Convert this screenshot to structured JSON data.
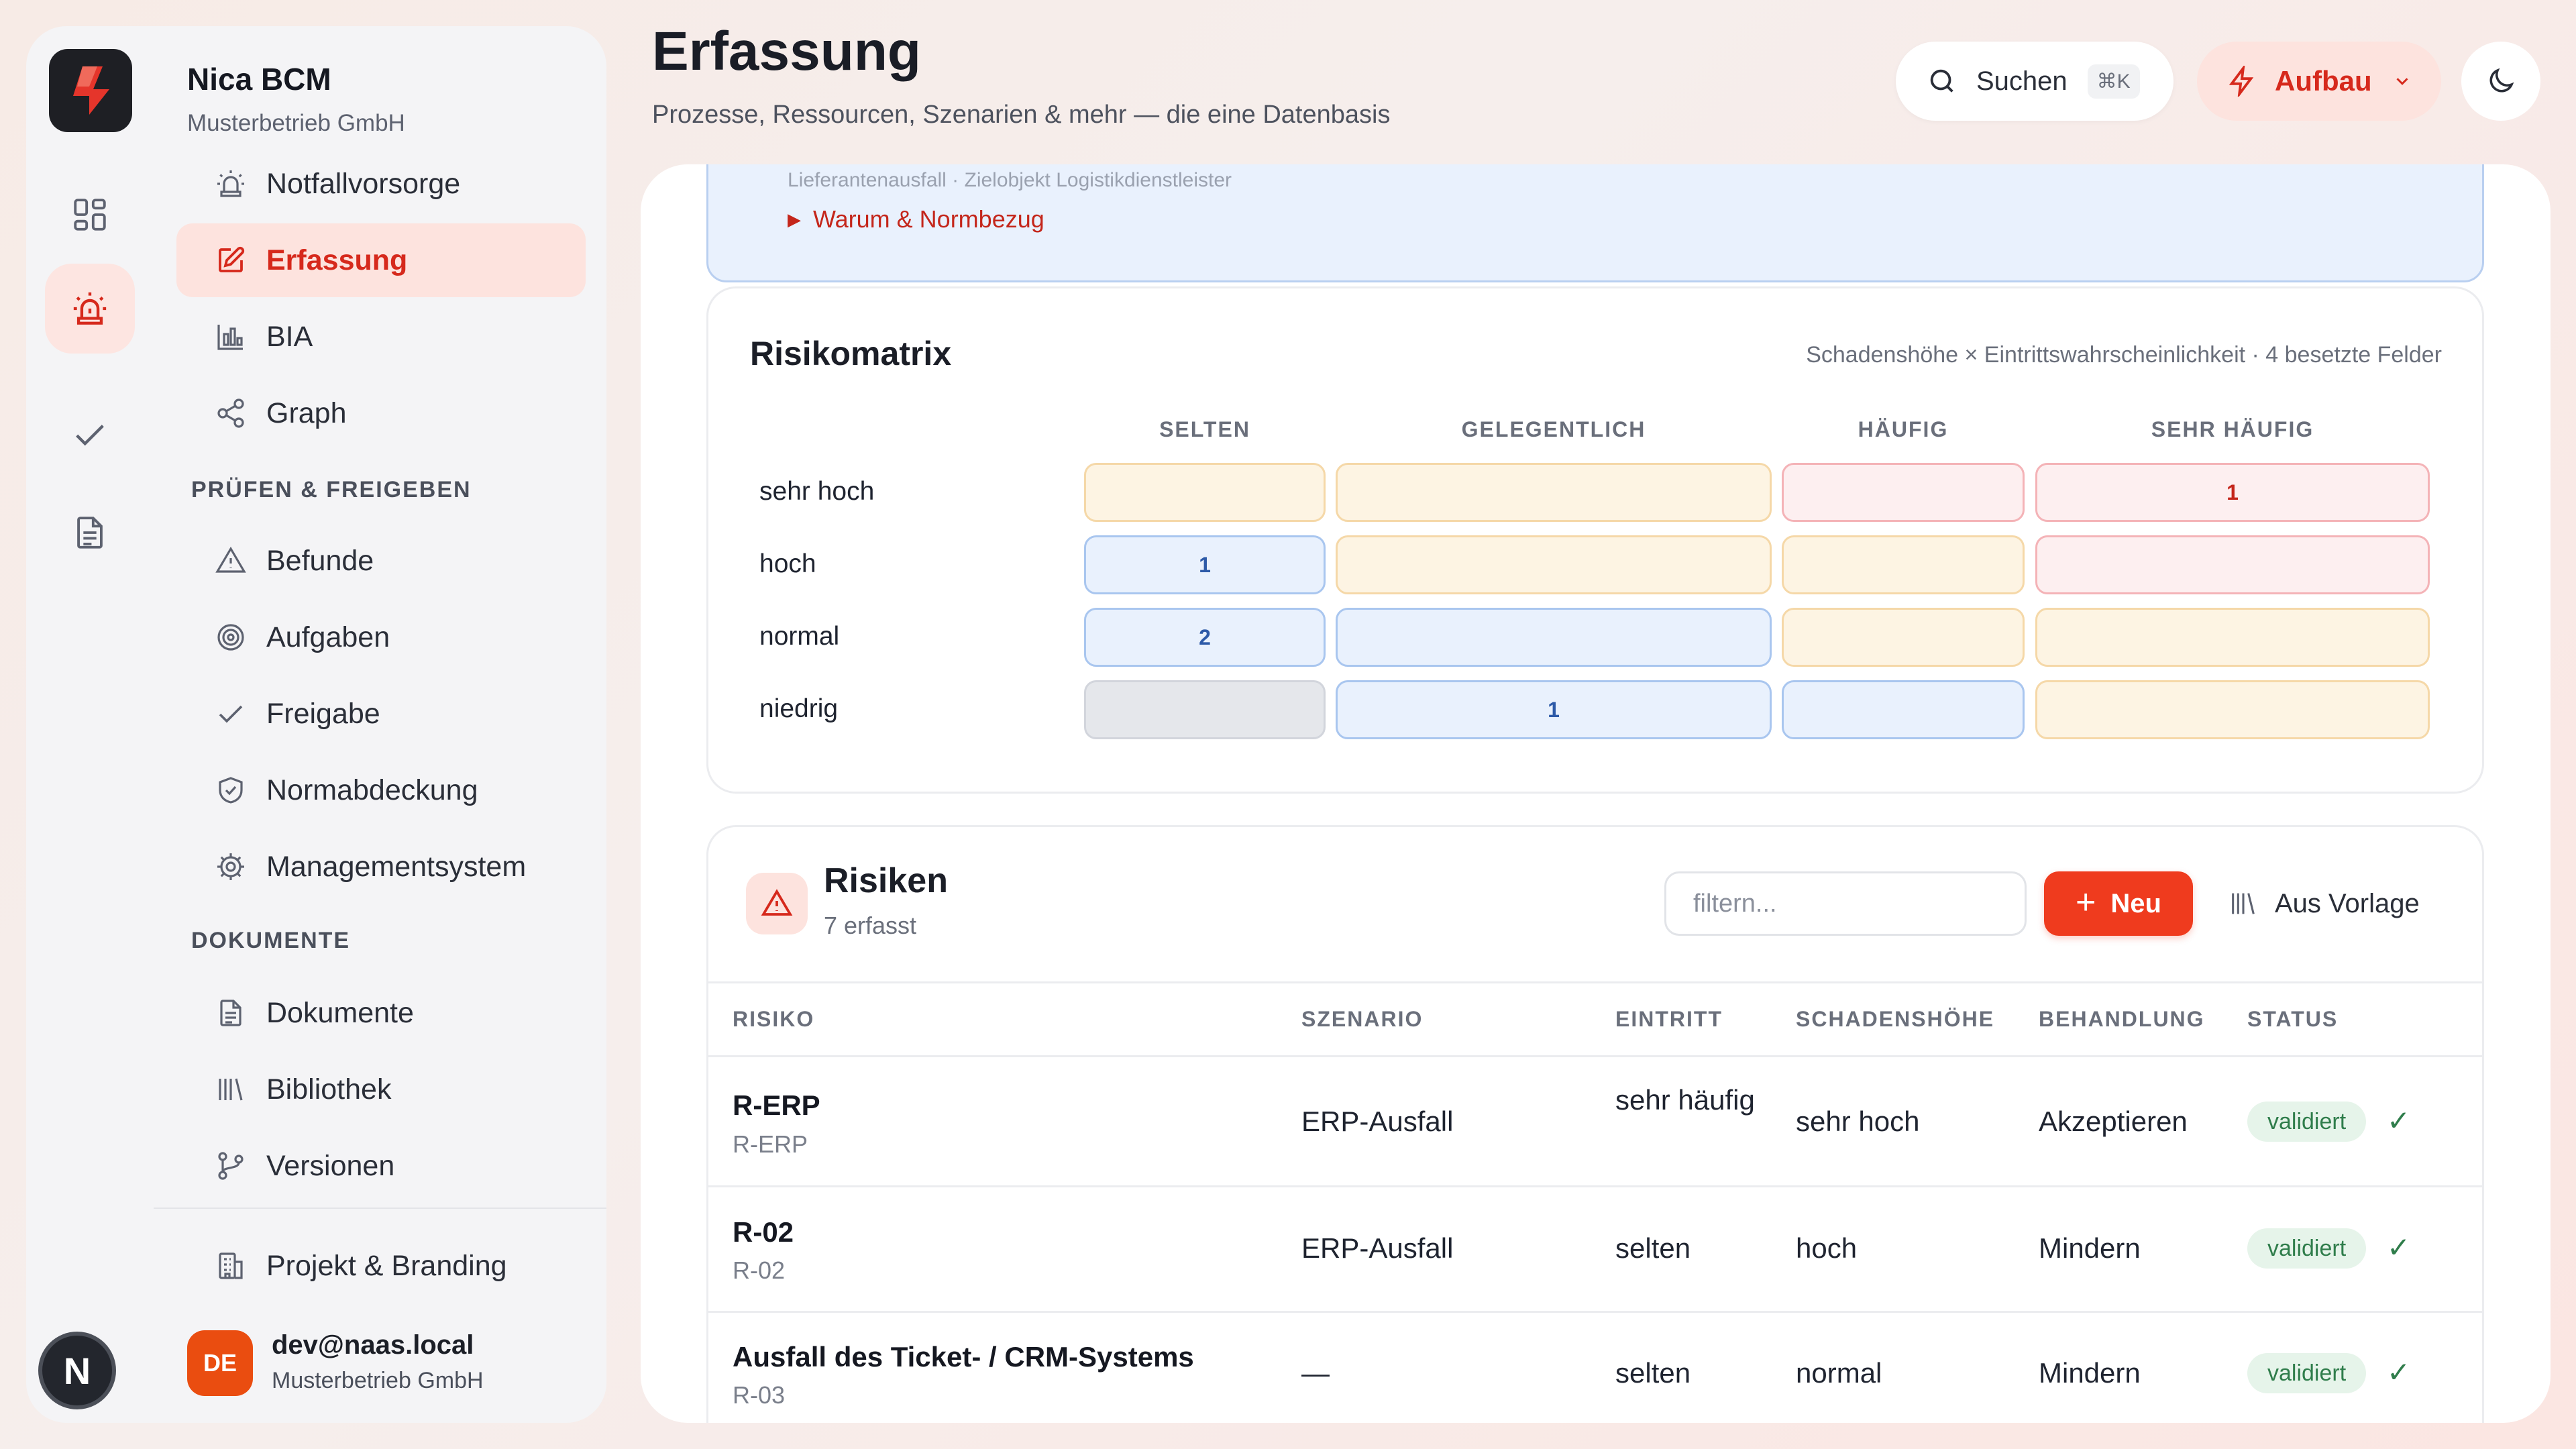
{
  "brand": {
    "name": "Nica BCM",
    "org": "Musterbetrieb GmbH"
  },
  "rail": {
    "avatar_letter": "N"
  },
  "nav": {
    "items_top": [
      {
        "label": "Notfallvorsorge",
        "icon": "siren-icon"
      },
      {
        "label": "Erfassung",
        "icon": "edit-icon",
        "active": true
      },
      {
        "label": "BIA",
        "icon": "bar-chart-icon"
      },
      {
        "label": "Graph",
        "icon": "share-graph-icon"
      }
    ],
    "section_review": "PRÜFEN & FREIGEBEN",
    "items_review": [
      {
        "label": "Befunde",
        "icon": "warning-icon"
      },
      {
        "label": "Aufgaben",
        "icon": "target-icon"
      },
      {
        "label": "Freigabe",
        "icon": "check-icon"
      },
      {
        "label": "Normabdeckung",
        "icon": "shield-check-icon"
      },
      {
        "label": "Managementsystem",
        "icon": "gear-icon"
      }
    ],
    "section_docs": "DOKUMENTE",
    "items_docs": [
      {
        "label": "Dokumente",
        "icon": "document-icon"
      },
      {
        "label": "Bibliothek",
        "icon": "library-icon"
      },
      {
        "label": "Versionen",
        "icon": "git-branch-icon"
      }
    ],
    "project": {
      "label": "Projekt & Branding",
      "icon": "building-icon"
    }
  },
  "user": {
    "initials": "DE",
    "email": "dev@naas.local",
    "org": "Musterbetrieb GmbH"
  },
  "header": {
    "title": "Erfassung",
    "subtitle": "Prozesse, Ressourcen, Szenarien & mehr — die eine Datenbasis",
    "search_label": "Suchen",
    "search_shortcut": "⌘K",
    "mode_label": "Aufbau"
  },
  "info": {
    "cut_text": "Lieferantenausfall · Zielobjekt Logistikdienstleister",
    "why_link": "Warum & Normbezug"
  },
  "matrix": {
    "title": "Risikomatrix",
    "subtitle": "Schadenshöhe × Eintrittswahrscheinlichkeit · 4 besetzte Felder",
    "columns": [
      "SELTEN",
      "GELEGENTLICH",
      "HÄUFIG",
      "SEHR HÄUFIG"
    ],
    "rows": [
      "sehr hoch",
      "hoch",
      "normal",
      "niedrig"
    ],
    "cells": [
      [
        {
          "tone": "amber",
          "value": ""
        },
        {
          "tone": "amber",
          "value": ""
        },
        {
          "tone": "red",
          "value": ""
        },
        {
          "tone": "red",
          "value": "1"
        }
      ],
      [
        {
          "tone": "blue",
          "value": "1"
        },
        {
          "tone": "amber",
          "value": ""
        },
        {
          "tone": "amber",
          "value": ""
        },
        {
          "tone": "red",
          "value": ""
        }
      ],
      [
        {
          "tone": "blue",
          "value": "2"
        },
        {
          "tone": "blue",
          "value": ""
        },
        {
          "tone": "amber",
          "value": ""
        },
        {
          "tone": "amber",
          "value": ""
        }
      ],
      [
        {
          "tone": "gray",
          "value": ""
        },
        {
          "tone": "blue",
          "value": "1"
        },
        {
          "tone": "blue",
          "value": ""
        },
        {
          "tone": "amber",
          "value": ""
        }
      ]
    ]
  },
  "risks": {
    "title": "Risiken",
    "count_label": "7 erfasst",
    "filter_placeholder": "filtern...",
    "new_label": "Neu",
    "template_label": "Aus Vorlage",
    "columns": [
      "RISIKO",
      "SZENARIO",
      "EINTRITT",
      "SCHADENSHÖHE",
      "BEHANDLUNG",
      "STATUS"
    ],
    "rows": [
      {
        "name": "R-ERP",
        "id": "R-ERP",
        "scenario": "ERP-Ausfall",
        "occurrence": "sehr häufig",
        "impact": "sehr hoch",
        "treatment": "Akzeptieren",
        "status": "validiert"
      },
      {
        "name": "R-02",
        "id": "R-02",
        "scenario": "ERP-Ausfall",
        "occurrence": "selten",
        "impact": "hoch",
        "treatment": "Mindern",
        "status": "validiert"
      },
      {
        "name": "Ausfall des Ticket- / CRM-Systems",
        "id": "R-03",
        "scenario": "—",
        "occurrence": "selten",
        "impact": "normal",
        "treatment": "Mindern",
        "status": "validiert"
      }
    ]
  },
  "colors": {
    "accent": "#ef3b1e",
    "accent_soft": "#fde3de",
    "success": "#2f7d4b"
  }
}
